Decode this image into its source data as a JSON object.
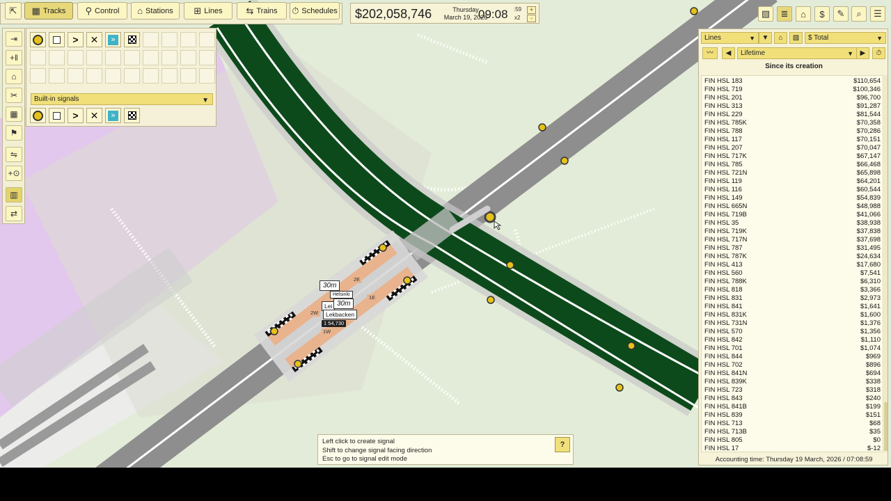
{
  "toolbar": {
    "buttons": [
      {
        "label": "Tracks",
        "icon": "tracks-icon",
        "active": true
      },
      {
        "label": "Control",
        "icon": "control-icon",
        "active": false
      },
      {
        "label": "Stations",
        "icon": "stations-icon",
        "active": false
      },
      {
        "label": "Lines",
        "icon": "lines-icon",
        "active": false
      },
      {
        "label": "Trains",
        "icon": "trains-icon",
        "active": false
      },
      {
        "label": "Schedules",
        "icon": "schedules-icon",
        "active": false
      }
    ]
  },
  "status": {
    "money": "$202,058,746",
    "weekday": "Thursday",
    "date": "March 19, 2026",
    "time": "09:08",
    "seconds": ":59",
    "speed": "x2",
    "speed_up": "+",
    "speed_down": "-"
  },
  "signal_panel": {
    "builtin_label": "Built-in signals"
  },
  "lines_panel": {
    "category": "Lines",
    "metric": "$ Total",
    "period": "Lifetime",
    "since_label": "Since its creation",
    "accounting_time": "Accounting time: Thursday 19 March, 2026 / 07:08:59",
    "rows": [
      {
        "name": "FIN HSL 183",
        "value": "$110,654"
      },
      {
        "name": "FIN HSL 719",
        "value": "$100,346"
      },
      {
        "name": "FIN HSL 201",
        "value": "$96,700"
      },
      {
        "name": "FIN HSL 313",
        "value": "$91,287"
      },
      {
        "name": "FIN HSL 229",
        "value": "$81,544"
      },
      {
        "name": "FIN HSL 785K",
        "value": "$70,358"
      },
      {
        "name": "FIN HSL 788",
        "value": "$70,286"
      },
      {
        "name": "FIN HSL 117",
        "value": "$70,151"
      },
      {
        "name": "FIN HSL 207",
        "value": "$70,047"
      },
      {
        "name": "FIN HSL 717K",
        "value": "$67,147"
      },
      {
        "name": "FIN HSL 785",
        "value": "$66,468"
      },
      {
        "name": "FIN HSL 721N",
        "value": "$65,898"
      },
      {
        "name": "FIN HSL 119",
        "value": "$64,201"
      },
      {
        "name": "FIN HSL 116",
        "value": "$60,544"
      },
      {
        "name": "FIN HSL 149",
        "value": "$54,839"
      },
      {
        "name": "FIN HSL 665N",
        "value": "$48,988"
      },
      {
        "name": "FIN HSL 719B",
        "value": "$41,066"
      },
      {
        "name": "FIN HSL 35",
        "value": "$38,938"
      },
      {
        "name": "FIN HSL 719K",
        "value": "$37,838"
      },
      {
        "name": "FIN HSL 717N",
        "value": "$37,698"
      },
      {
        "name": "FIN HSL 787",
        "value": "$31,495"
      },
      {
        "name": "FIN HSL 787K",
        "value": "$24,634"
      },
      {
        "name": "FIN HSL 413",
        "value": "$17,680"
      },
      {
        "name": "FIN HSL 560",
        "value": "$7,541"
      },
      {
        "name": "FIN HSL 788K",
        "value": "$6,310"
      },
      {
        "name": "FIN HSL 818",
        "value": "$3,366"
      },
      {
        "name": "FIN HSL 831",
        "value": "$2,973"
      },
      {
        "name": "FIN HSL 841",
        "value": "$1,641"
      },
      {
        "name": "FIN HSL 831K",
        "value": "$1,600"
      },
      {
        "name": "FIN HSL 731N",
        "value": "$1,376"
      },
      {
        "name": "FIN HSL 570",
        "value": "$1,356"
      },
      {
        "name": "FIN HSL 842",
        "value": "$1,110"
      },
      {
        "name": "FIN HSL 701",
        "value": "$1,074"
      },
      {
        "name": "FIN HSL 844",
        "value": "$969"
      },
      {
        "name": "FIN HSL 702",
        "value": "$896"
      },
      {
        "name": "FIN HSL 841N",
        "value": "$694"
      },
      {
        "name": "FIN HSL 839K",
        "value": "$338"
      },
      {
        "name": "FIN HSL 723",
        "value": "$318"
      },
      {
        "name": "FIN HSL 843",
        "value": "$240"
      },
      {
        "name": "FIN HSL 841B",
        "value": "$199"
      },
      {
        "name": "FIN HSL 839",
        "value": "$151"
      },
      {
        "name": "FIN HSL 713",
        "value": "$68"
      },
      {
        "name": "FIN HSL 713B",
        "value": "$35"
      },
      {
        "name": "FIN HSL 805",
        "value": "$0"
      },
      {
        "name": "FIN HSL 17",
        "value": "$-12"
      }
    ]
  },
  "hints": {
    "line1": "Left click to create signal",
    "line2": "Shift to change signal facing direction",
    "line3": "Esc to go to signal edit mode",
    "help": "?"
  },
  "map": {
    "length_label_1": "30m",
    "length_label_2": "30m",
    "station_name": "Lekbacken",
    "station_name_top": "Helsinki",
    "station_partial": "Lei",
    "station_stats": "1  54,730",
    "platform_labels": [
      "2E",
      "1E",
      "2W",
      "1W"
    ]
  },
  "colors": {
    "panel_bg": "#f7f3d9",
    "accent_yellow": "#f1e07a",
    "track_green": "#0d4a1b",
    "road_gray": "#8e8e8e",
    "signal_yellow": "#e5c21a"
  }
}
